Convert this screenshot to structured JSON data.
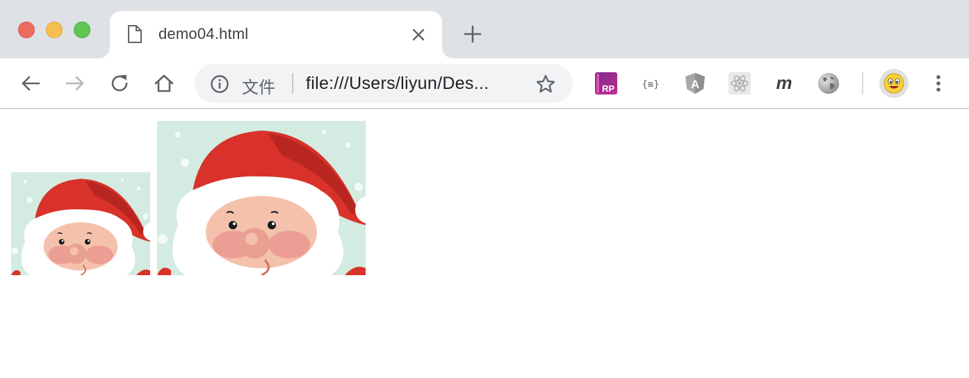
{
  "window": {
    "traffic_lights": [
      "close",
      "minimize",
      "maximize"
    ]
  },
  "tab": {
    "title": "demo04.html",
    "icon": "file-icon"
  },
  "toolbar": {
    "scheme_label": "文件",
    "url": "file:///Users/liyun/Des...",
    "icons": [
      "back-icon",
      "forward-icon",
      "reload-icon",
      "home-icon",
      "info-icon",
      "star-icon"
    ]
  },
  "extensions": {
    "axure_label": "RP",
    "json_label": "{≡}",
    "angular_label": "A",
    "m_label": "m",
    "icons": [
      "axure-rp-icon",
      "json-viewer-icon",
      "angular-icon",
      "react-icon",
      "m-icon",
      "globe-icon"
    ]
  },
  "content": {
    "images": [
      {
        "name": "santa-image-small",
        "description_icon": "santa-icon"
      },
      {
        "name": "santa-image-large",
        "description_icon": "santa-icon"
      }
    ]
  },
  "colors": {
    "tabstrip_bg": "#dee1e6",
    "omnibox_bg": "#f1f3f4",
    "santa_hat": "#d8322b",
    "santa_bg": "#cfe7dc"
  }
}
